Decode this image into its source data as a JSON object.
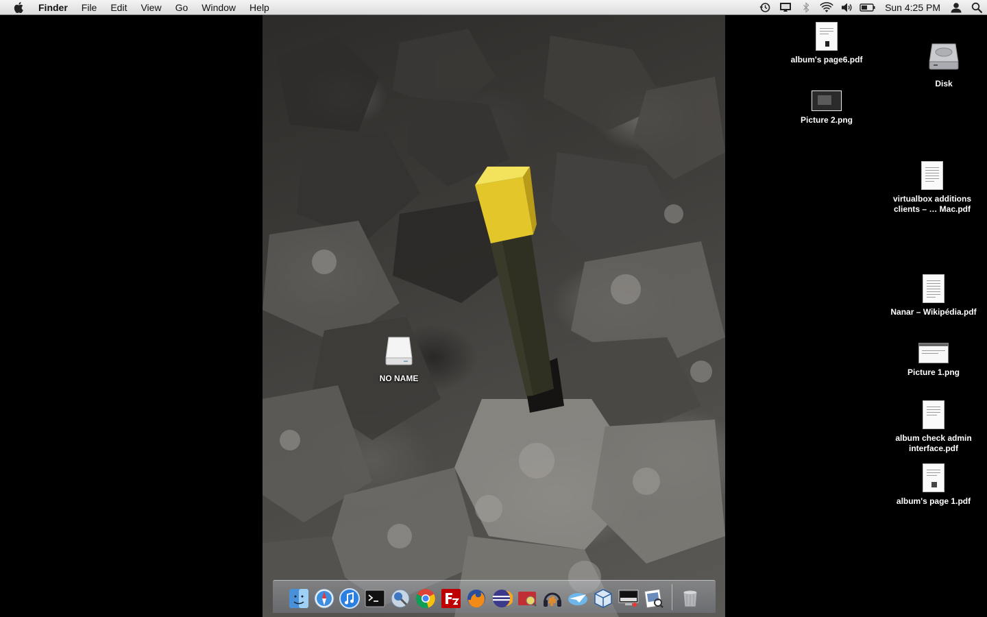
{
  "menubar": {
    "app_name": "Finder",
    "menus": [
      "File",
      "Edit",
      "View",
      "Go",
      "Window",
      "Help"
    ],
    "status_icons": [
      "time-machine-icon",
      "display-icon",
      "bluetooth-icon",
      "wifi-icon",
      "volume-icon",
      "battery-icon"
    ],
    "clock": "Sun 4:25 PM"
  },
  "desktop": {
    "icons": {
      "album_page6": "album's page6.pdf",
      "picture2": "Picture 2.png",
      "disk": "Disk",
      "virtualbox": "virtualbox additions clients – … Mac.pdf",
      "nanar": "Nanar – Wikipédia.pdf",
      "picture1": "Picture 1.png",
      "album_check": "album check admin interface.pdf",
      "album_page1": "album's page 1.pdf",
      "no_name": "NO NAME"
    }
  },
  "dock": {
    "apps": [
      "Finder",
      "Safari",
      "iTunes",
      "Terminal",
      "Network Utility",
      "Google Chrome",
      "FileZilla",
      "Firefox",
      "Eclipse",
      "Cyberduck",
      "Audacity",
      "Mail",
      "VirtualBox",
      "Remote Desktop",
      "Preview",
      "Trash"
    ]
  }
}
